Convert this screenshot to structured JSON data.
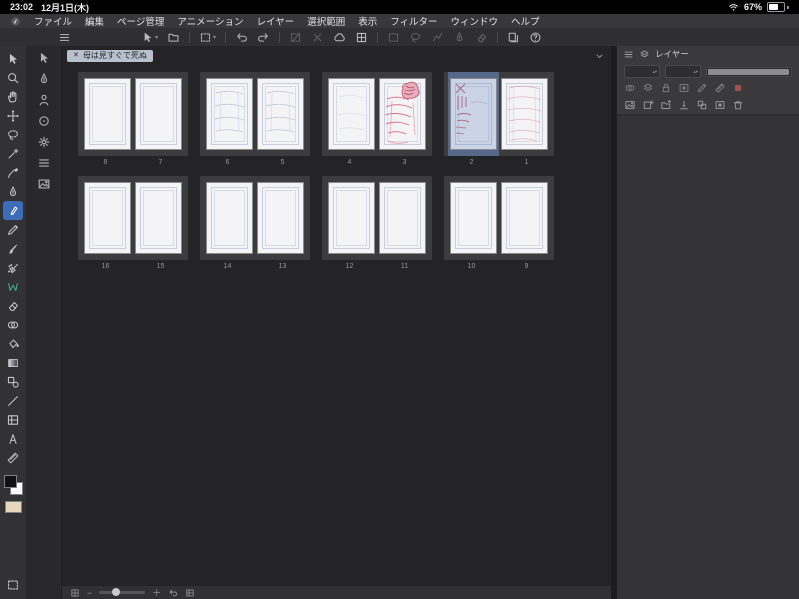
{
  "status_bar": {
    "time": "23:02",
    "date": "12月1日(木)",
    "battery_percent": "67%",
    "icons": [
      "wifi-icon",
      "battery-icon"
    ]
  },
  "menu_bar": {
    "logo_icon": "clip-studio-logo-icon",
    "menus": [
      "ファイル",
      "編集",
      "ページ管理",
      "アニメーション",
      "レイヤー",
      "選択範囲",
      "表示",
      "フィルター",
      "ウィンドウ",
      "ヘルプ"
    ]
  },
  "toolbar": {
    "icons": [
      {
        "name": "main-menu-icon",
        "symbol": "burger"
      },
      {
        "spacer": 52
      },
      {
        "name": "operation-icon",
        "symbol": "cursor",
        "chevron": true
      },
      {
        "name": "open-canvas-icon",
        "symbol": "folder"
      },
      {
        "sep": true
      },
      {
        "name": "transform-icon",
        "symbol": "dashed-rect",
        "chevron": true
      },
      {
        "sep": true
      },
      {
        "name": "undo-icon",
        "symbol": "undo"
      },
      {
        "name": "redo-icon",
        "symbol": "redo"
      },
      {
        "sep": true
      },
      {
        "name": "deselect-icon",
        "symbol": "deselect",
        "grayed": true
      },
      {
        "name": "clear-selection-icon",
        "symbol": "close",
        "grayed": true
      },
      {
        "name": "cloud-sync-icon",
        "symbol": "cloud"
      },
      {
        "name": "snap-grid-icon",
        "symbol": "grid"
      },
      {
        "sep": true
      },
      {
        "name": "select-rectangle-icon",
        "symbol": "dashed-rect",
        "grayed": true
      },
      {
        "name": "select-lasso-icon",
        "symbol": "lasso",
        "grayed": true
      },
      {
        "name": "select-polyline-icon",
        "symbol": "polyline",
        "grayed": true
      },
      {
        "name": "select-pen-icon",
        "symbol": "pen",
        "grayed": true
      },
      {
        "name": "select-eraser-icon",
        "symbol": "eraser",
        "grayed": true
      },
      {
        "sep": true
      },
      {
        "name": "page-manager-icon",
        "symbol": "pages"
      },
      {
        "name": "help-icon",
        "symbol": "help"
      }
    ]
  },
  "tool_column": {
    "tools": [
      {
        "name": "operation-tool",
        "symbol": "cursor"
      },
      {
        "name": "zoom-tool",
        "symbol": "magnifier"
      },
      {
        "name": "hand-tool",
        "symbol": "hand"
      },
      {
        "name": "move-layer-tool",
        "symbol": "move"
      },
      {
        "name": "lasso-tool",
        "symbol": "lasso"
      },
      {
        "name": "auto-select-tool",
        "symbol": "wand"
      },
      {
        "name": "eyedropper-tool",
        "symbol": "dropper"
      },
      {
        "name": "pen-tool",
        "symbol": "pen"
      },
      {
        "name": "marker-tool",
        "symbol": "marker",
        "selected": true
      },
      {
        "name": "pencil-tool",
        "symbol": "pencil"
      },
      {
        "name": "brush-tool",
        "symbol": "brush"
      },
      {
        "name": "airbrush-tool",
        "symbol": "airbrush"
      },
      {
        "name": "watercolor-tool",
        "symbol": "watercolor",
        "accent": "#3fae9b"
      },
      {
        "name": "eraser-tool",
        "symbol": "eraser"
      },
      {
        "name": "blend-tool",
        "symbol": "blend"
      },
      {
        "name": "fill-tool",
        "symbol": "bucket"
      },
      {
        "name": "gradient-tool",
        "symbol": "gradient"
      },
      {
        "name": "figure-tool",
        "symbol": "figure"
      },
      {
        "name": "line-tool",
        "symbol": "line"
      },
      {
        "name": "frame-border-tool",
        "symbol": "frame"
      },
      {
        "name": "text-tool",
        "symbol": "text"
      },
      {
        "name": "ruler-tool",
        "symbol": "ruler"
      }
    ],
    "colors": {
      "main": "#111113",
      "sub": "#ffffff",
      "tone": "#e6d7bd"
    }
  },
  "side_column": {
    "icons": [
      {
        "name": "subtool-cursor-icon",
        "symbol": "cursor"
      },
      {
        "name": "subtool-pen-icon",
        "symbol": "pen"
      },
      {
        "name": "subtool-person-icon",
        "symbol": "person"
      },
      {
        "name": "subtool-target-icon",
        "symbol": "target"
      },
      {
        "name": "subtool-settings-icon",
        "symbol": "gear"
      },
      {
        "name": "subtool-list-icon",
        "symbol": "burger"
      },
      {
        "name": "subtool-image-icon",
        "symbol": "image"
      }
    ]
  },
  "canvas": {
    "tab": {
      "close_glyph": "✕",
      "title": "母は見すぐで死ぬ"
    },
    "rows": [
      [
        {
          "pages": [
            {
              "number": "8",
              "sketch": "none"
            },
            {
              "number": "7",
              "sketch": "none"
            }
          ]
        },
        {
          "pages": [
            {
              "number": "6",
              "sketch": "blue"
            },
            {
              "number": "5",
              "sketch": "blue"
            }
          ]
        },
        {
          "pages": [
            {
              "number": "4",
              "sketch": "blue_faint"
            },
            {
              "number": "3",
              "sketch": "red_heavy"
            }
          ]
        },
        {
          "pages": [
            {
              "number": "2",
              "sketch": "red_marks",
              "selected": true
            },
            {
              "number": "1",
              "sketch": "red_light"
            }
          ]
        }
      ],
      [
        {
          "pages": [
            {
              "number": "16",
              "sketch": "none"
            },
            {
              "number": "15",
              "sketch": "none"
            }
          ]
        },
        {
          "pages": [
            {
              "number": "14",
              "sketch": "none"
            },
            {
              "number": "13",
              "sketch": "none"
            }
          ]
        },
        {
          "pages": [
            {
              "number": "12",
              "sketch": "none"
            },
            {
              "number": "11",
              "sketch": "none"
            }
          ]
        },
        {
          "pages": [
            {
              "number": "10",
              "sketch": "none"
            },
            {
              "number": "9",
              "sketch": "none"
            }
          ]
        }
      ]
    ]
  },
  "bottom_bar": {
    "icons": [
      {
        "name": "navigator-icon",
        "symbol": "grid"
      },
      {
        "name": "zoom-out-button",
        "glyph": "−"
      },
      {
        "name": "zoom-slider"
      },
      {
        "name": "zoom-in-button",
        "glyph": "＋"
      },
      {
        "name": "rotate-reset-icon",
        "symbol": "undo"
      },
      {
        "name": "fit-screen-icon",
        "symbol": "frame"
      }
    ]
  },
  "layer_panel": {
    "title": "レイヤー",
    "header_icons": [
      {
        "name": "panel-menu-icon",
        "symbol": "burger"
      },
      {
        "name": "layers-icon",
        "symbol": "layers"
      }
    ],
    "property_icons": [
      {
        "name": "blend-mode-icon",
        "symbol": "blend"
      },
      {
        "name": "clip-to-layer-icon",
        "symbol": "layers"
      },
      {
        "name": "lock-layer-icon",
        "symbol": "lock"
      },
      {
        "name": "lock-transparent-icon",
        "symbol": "mask"
      },
      {
        "name": "draft-layer-icon",
        "symbol": "pencil"
      },
      {
        "name": "layer-ruler-icon",
        "symbol": "ruler"
      },
      {
        "name": "layer-color-icon",
        "symbol": "red-square",
        "accent": "#a2524e"
      }
    ],
    "action_icons": [
      {
        "name": "layer-list-icon",
        "symbol": "image"
      },
      {
        "name": "new-layer-button",
        "symbol": "new-layer"
      },
      {
        "name": "new-folder-button",
        "symbol": "folder-plus"
      },
      {
        "name": "transfer-down-button",
        "symbol": "transfer-down"
      },
      {
        "name": "merge-down-button",
        "symbol": "combine"
      },
      {
        "name": "layer-mask-button",
        "symbol": "mask"
      },
      {
        "name": "delete-layer-button",
        "symbol": "trash"
      }
    ]
  }
}
